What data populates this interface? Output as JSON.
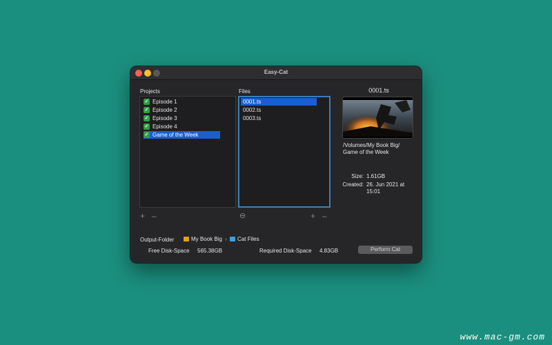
{
  "window": {
    "title": "Easy-Cat"
  },
  "projects": {
    "label": "Projects",
    "items": [
      {
        "label": "Episode 1",
        "checked": true,
        "selected": false
      },
      {
        "label": "Episode 2",
        "checked": true,
        "selected": false
      },
      {
        "label": "Episode 3",
        "checked": true,
        "selected": false
      },
      {
        "label": "Episode 4",
        "checked": true,
        "selected": false
      },
      {
        "label": "Game of the Week",
        "checked": true,
        "selected": true
      }
    ],
    "add_symbol": "+",
    "remove_symbol": "–"
  },
  "files": {
    "label": "Files",
    "items": [
      {
        "label": "0001.ts",
        "selected": true
      },
      {
        "label": "0002.ts",
        "selected": false
      },
      {
        "label": "0003.ts",
        "selected": false
      }
    ],
    "minus_circle_symbol": "⊖",
    "add_symbol": "+",
    "remove_symbol": "–"
  },
  "preview": {
    "title": "0001.ts",
    "path_line1": "/Volumes/My Book Big/",
    "path_line2": "Game of the Week",
    "size_label": "Size:",
    "size_value": "1.61GB",
    "created_label": "Created:",
    "created_line1": "26. Jun 2021 at",
    "created_line2": "15:01"
  },
  "output": {
    "label": "Output-Folder",
    "path_part1": "My Book Big",
    "separator": "›",
    "path_part2": "Cat Files"
  },
  "disk": {
    "free_label": "Free Disk-Space",
    "free_value": "565.38GB",
    "required_label": "Required Disk-Space",
    "required_value": "4.83GB"
  },
  "actions": {
    "perform_label": "Perform Cat"
  },
  "watermark": "www.mac-gm.com",
  "colors": {
    "background": "#1b8f7f",
    "selection": "#1a5fd0",
    "focus_ring": "#3d7fb6",
    "check": "#2ea043"
  }
}
